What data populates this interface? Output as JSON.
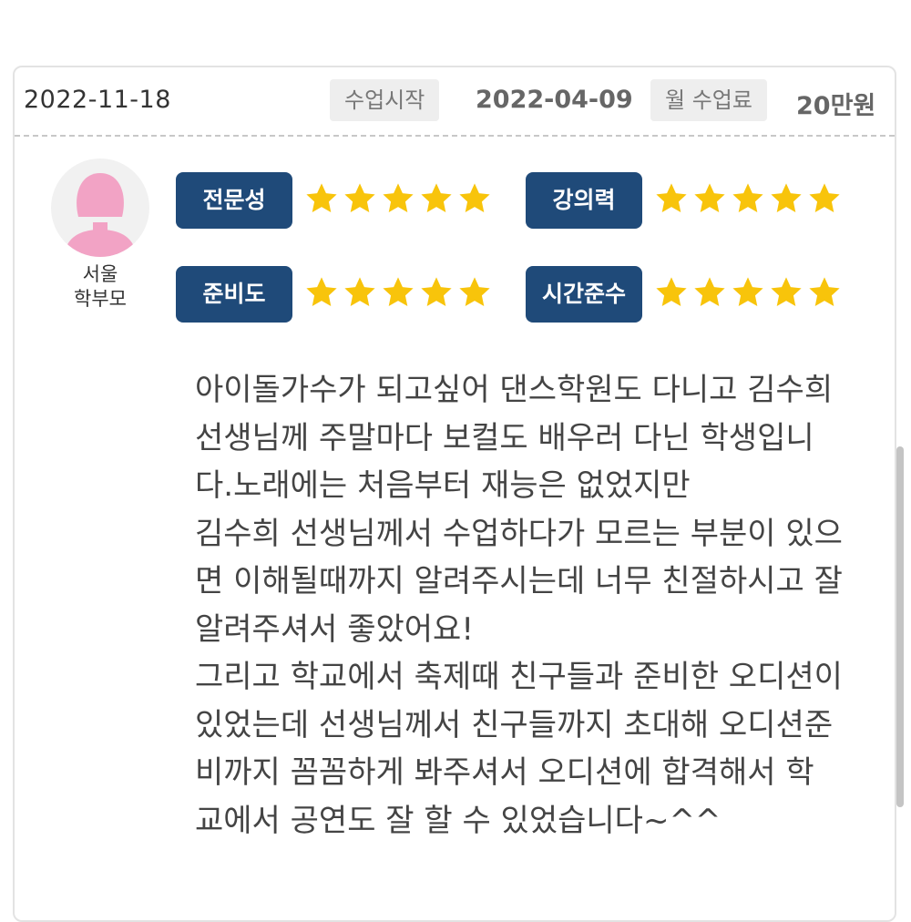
{
  "review": {
    "date": "2022-11-18",
    "start_label": "수업시작",
    "start_date": "2022-04-09",
    "fee_label": "월 수업료",
    "fee_value": "20만원",
    "author_region": "서울",
    "author_role": "학부모",
    "avatar_icon": "female-user-icon",
    "ratings": [
      {
        "label": "전문성",
        "stars": 5
      },
      {
        "label": "강의력",
        "stars": 5
      },
      {
        "label": "준비도",
        "stars": 5
      },
      {
        "label": "시간준수",
        "stars": 5
      }
    ],
    "text": "아이돌가수가 되고싶어 댄스학원도 다니고 김수희\n선생님께 주말마다 보컬도 배우러 다닌 학생입니\n다.노래에는 처음부터 재능은 없었지만\n김수희 선생님께서 수업하다가 모르는 부분이 있으\n면 이해될때까지 알려주시는데 너무 친절하시고 잘\n알려주셔서 좋았어요!\n그리고 학교에서 축제때 친구들과 준비한 오디션이\n있었는데 선생님께서 친구들까지 초대해 오디션준\n비까지 꼼꼼하게   봐주셔서 오디션에 합격해서 학\n교에서 공연도 잘 할 수 있었습니다~^^"
  },
  "colors": {
    "badge": "#1f4a79",
    "star": "#f8c40b",
    "avatar": "#f2a3c5"
  }
}
